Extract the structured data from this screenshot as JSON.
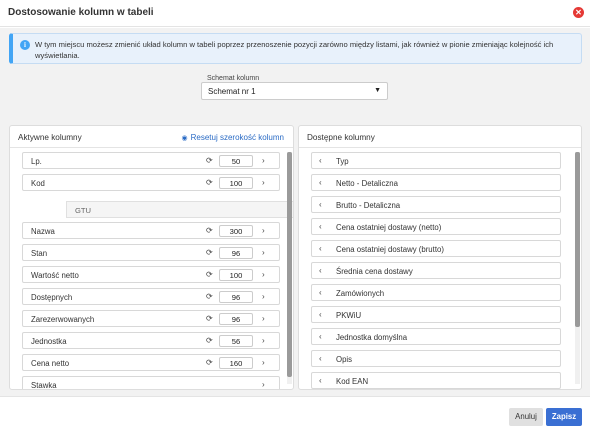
{
  "dialog": {
    "title": "Dostosowanie kolumn w tabeli",
    "close_icon": "close-icon",
    "close_color": "#e53935"
  },
  "info": {
    "icon": "info-icon",
    "text": "W tym miejscu możesz zmienić układ kolumn w tabeli poprzez przenoszenie pozycji zarówno między listami, jak również w pionie zmieniając kolejność ich wyświetlania."
  },
  "schema": {
    "label": "Schemat kolumn",
    "value": "Schemat nr 1",
    "caret": "▼"
  },
  "active": {
    "title": "Aktywne kolumny",
    "reset_label": "Resetuj szerokość kolumn",
    "reset_icon": "eye-icon",
    "sub_item": "GTU",
    "items": [
      {
        "label": "Lp.",
        "width": "50",
        "has_width": true
      },
      {
        "label": "Kod",
        "width": "100",
        "has_width": true
      },
      {
        "label": "Nazwa",
        "width": "300",
        "has_width": true
      },
      {
        "label": "Stan",
        "width": "96",
        "has_width": true
      },
      {
        "label": "Wartość netto",
        "width": "100",
        "has_width": true
      },
      {
        "label": "Dostępnych",
        "width": "96",
        "has_width": true
      },
      {
        "label": "Zarezerwowanych",
        "width": "96",
        "has_width": true
      },
      {
        "label": "Jednostka",
        "width": "56",
        "has_width": true
      },
      {
        "label": "Cena netto",
        "width": "160",
        "has_width": true
      },
      {
        "label": "Stawka",
        "width": "",
        "has_width": false
      }
    ]
  },
  "available": {
    "title": "Dostępne kolumny",
    "items": [
      "Typ",
      "Netto - Detaliczna",
      "Brutto - Detaliczna",
      "Cena ostatniej dostawy (netto)",
      "Cena ostatniej dostawy (brutto)",
      "Średnia cena dostawy",
      "Zamówionych",
      "PKWiU",
      "Jednostka domyślna",
      "Opis",
      "Kod EAN"
    ]
  },
  "footer": {
    "cancel_label": "Anuluj",
    "save_label": "Zapisz"
  },
  "colors": {
    "accent": "#3a6fd3",
    "link": "#2a6bc5",
    "info_border": "#42a5f5"
  }
}
